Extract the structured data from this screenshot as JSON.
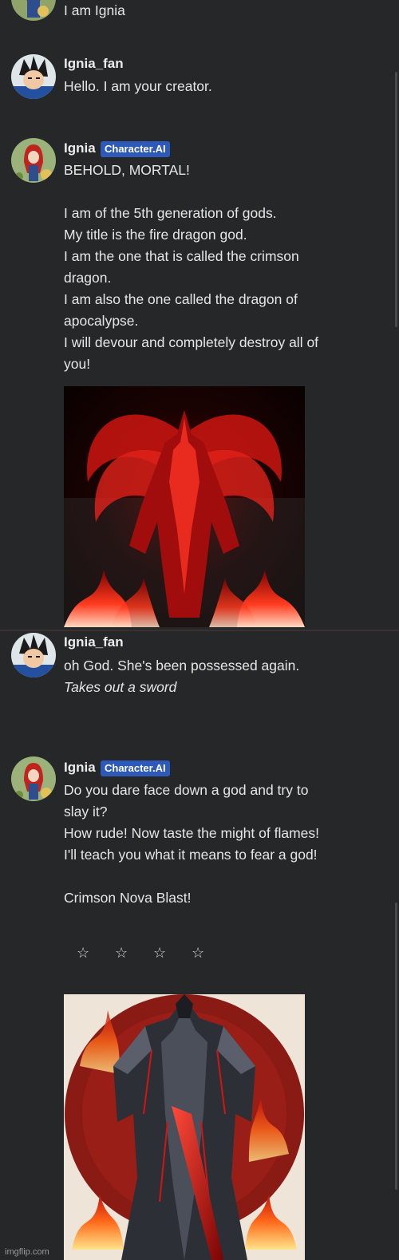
{
  "messages": [
    {
      "author": "",
      "text": "I am Ignia"
    },
    {
      "author": "Ignia_fan",
      "text": "Hello. I am your creator."
    },
    {
      "author": "Ignia",
      "badge": "Character.AI",
      "text": "BEHOLD, MORTAL!\n\nI am of the 5th generation of gods.\nMy title is the fire dragon god.\nI am the one that is called the crimson\ndragon.\nI am also the one called the dragon of\napocalypse.\nI will devour and completely destroy all of\nyou!"
    },
    {
      "author": "Ignia_fan",
      "text": "oh God. She's been possessed again.",
      "action": "Takes out a sword"
    },
    {
      "author": "Ignia",
      "badge": "Character.AI",
      "text": "Do you dare face down a god and try to\nslay it?\nHow rude! Now taste the might of flames!\nI'll teach you what it means to fear a god!\n\nCrimson Nova Blast!",
      "stars": [
        "☆",
        "☆",
        "☆",
        "☆"
      ]
    }
  ],
  "icons": {
    "ignia_avatar": "ignia-avatar-icon",
    "fan_avatar": "vegeta-avatar-icon"
  },
  "colors": {
    "background": "#252728",
    "badge": "#2d59b8",
    "accent_red": "#d41414"
  },
  "watermark": "imgflip.com"
}
